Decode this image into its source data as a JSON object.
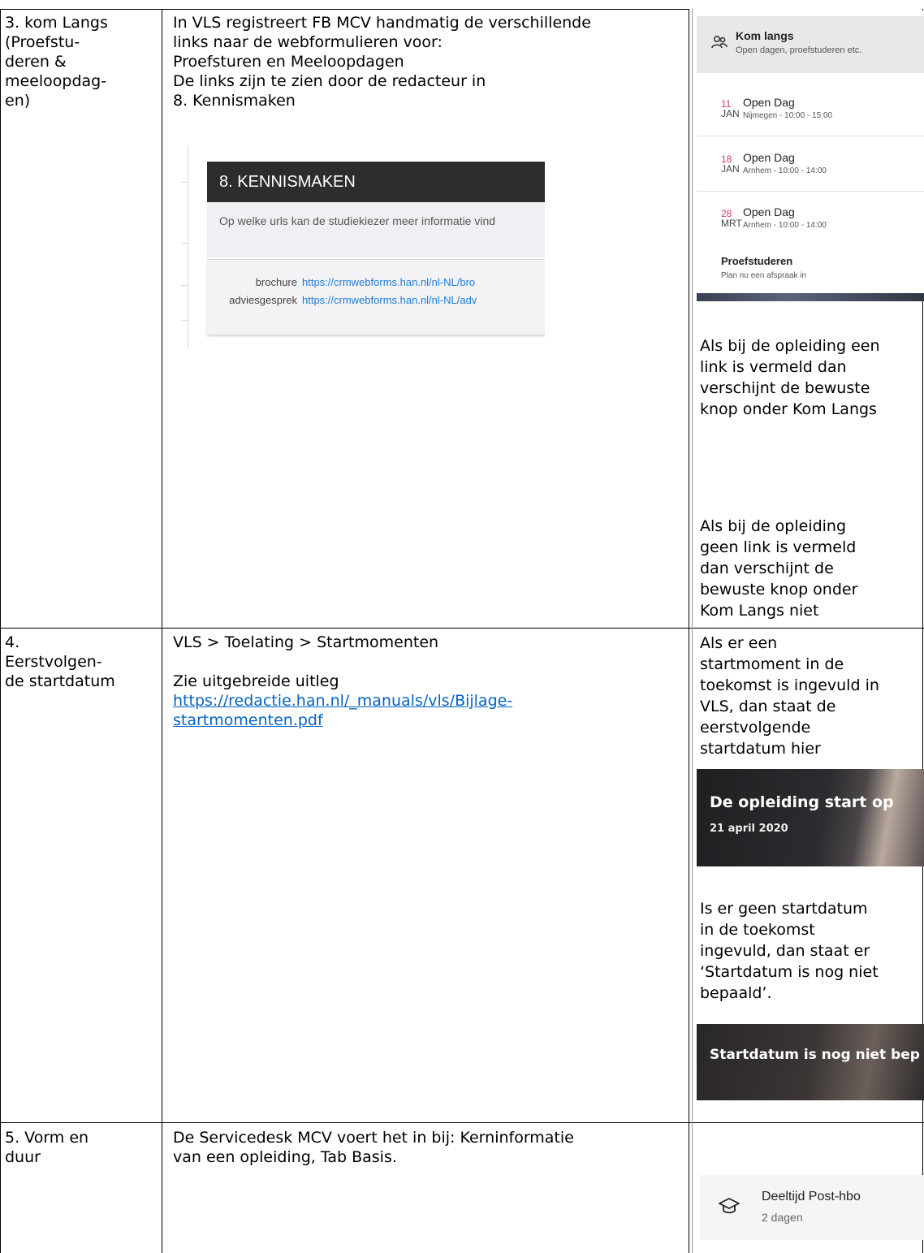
{
  "rows": [
    {
      "label_lines": [
        "3. kom Langs",
        "(Proefstu-",
        "deren &",
        "meeloopdag-",
        "en)"
      ],
      "middle_lines": [
        "In VLS registreert FB MCV handmatig de verschillende",
        "links naar de webformulieren voor:",
        "Proefsturen en Meeloopdagen",
        "De links zijn te zien door de redacteur in",
        "8. Kennismaken"
      ],
      "kennismaken": {
        "title": "8. KENNISMAKEN",
        "question": "Op welke urls kan de studiekiezer meer informatie vind",
        "links": [
          {
            "label": "brochure",
            "url": "https://crmwebforms.han.nl/nl-NL/bro"
          },
          {
            "label": "adviesgesprek",
            "url": "https://crmwebforms.han.nl/nl-NL/adv"
          }
        ]
      },
      "kom_langs": {
        "title": "Kom langs",
        "subtitle": "Open dagen, proefstuderen etc.",
        "events": [
          {
            "day": "11",
            "month": "JAN",
            "title": "Open Dag",
            "detail": "Nijmegen - 10:00 - 15:00"
          },
          {
            "day": "18",
            "month": "JAN",
            "title": "Open Dag",
            "detail": "Arnhem - 10:00 - 14:00"
          },
          {
            "day": "28",
            "month": "MRT",
            "title": "Open Dag",
            "detail": "Arnhem - 10:00 - 14:00"
          }
        ],
        "proef_title": "Proefstuderen",
        "proef_sub": "Plan nu een afspraak in"
      },
      "right_lines_a": [
        "Als bij de opleiding een",
        "link is vermeld dan",
        "verschijnt de bewuste",
        "knop onder Kom Langs"
      ],
      "right_lines_b": [
        "Als bij de opleiding",
        "geen link is vermeld",
        "dan verschijnt de",
        "bewuste knop onder",
        "Kom Langs niet"
      ]
    },
    {
      "label_lines": [
        "4.",
        "Eerstvolgen-",
        "de startdatum"
      ],
      "middle_line1": "VLS > Toelating > Startmomenten",
      "middle_line2": "Zie uitgebreide uitleg",
      "link_lines": [
        "https://redactie.han.nl/_manuals/vls/Bijlage-",
        "startmomenten.pdf"
      ],
      "right_lines_a": [
        "Als er een",
        "startmoment in de",
        "toekomst is ingevuld in",
        "VLS, dan staat de",
        "eerstvolgende",
        "startdatum hier"
      ],
      "banner1_title": "De opleiding start op",
      "banner1_date": "21 april 2020",
      "right_lines_b": [
        "Is er geen startdatum",
        "in de toekomst",
        "ingevuld, dan staat er",
        "‘Startdatum is nog niet",
        "bepaald’."
      ],
      "banner2_title": "Startdatum is nog niet bep"
    },
    {
      "label_lines": [
        "5. Vorm en",
        "duur"
      ],
      "middle_lines": [
        "De Servicedesk MCV voert het in bij: Kerninformatie",
        "van een opleiding, Tab Basis."
      ],
      "card_title": "Deeltijd Post-hbo",
      "card_sub": "2 dagen"
    }
  ]
}
